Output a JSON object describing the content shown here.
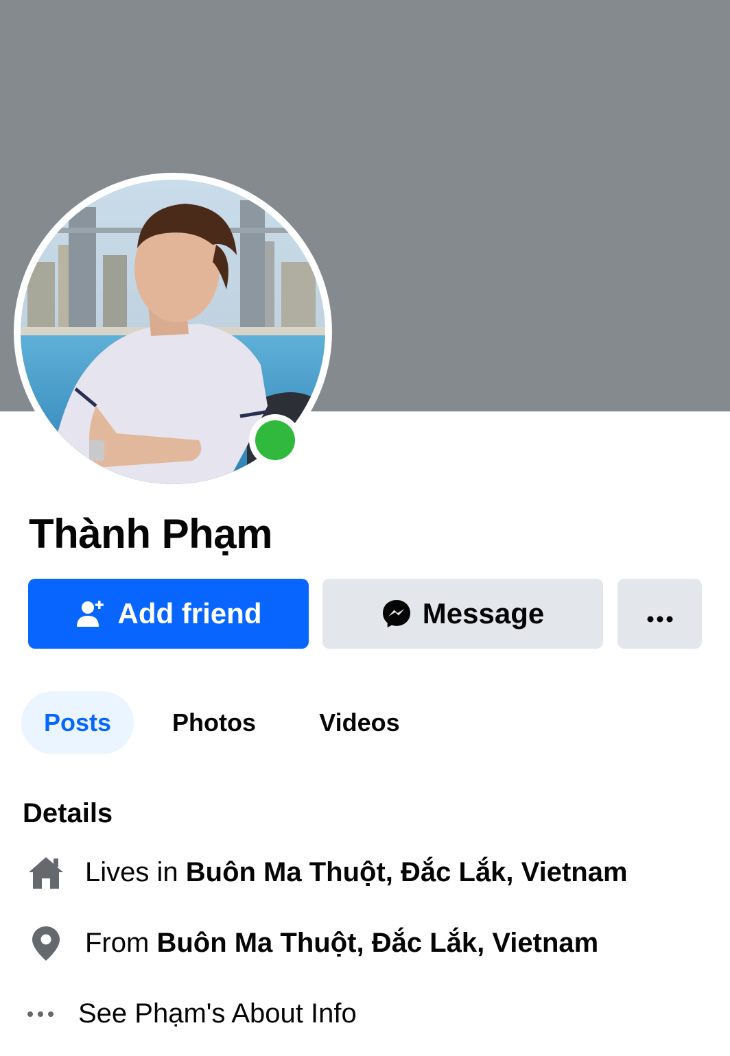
{
  "profile": {
    "name": "Thành Phạm",
    "online": true,
    "online_color": "#31b93d"
  },
  "actions": {
    "add_friend_label": "Add friend",
    "message_label": "Message",
    "more_label": "More"
  },
  "tabs": [
    {
      "label": "Posts",
      "active": true
    },
    {
      "label": "Photos",
      "active": false
    },
    {
      "label": "Videos",
      "active": false
    }
  ],
  "details": {
    "title": "Details",
    "lives_prefix": "Lives in ",
    "lives_value": "Buôn Ma Thuột, Đắc Lắk, Vietnam",
    "from_prefix": "From ",
    "from_value": "Buôn Ma Thuột, Đắc Lắk, Vietnam",
    "about_link": "See Phạm's About Info"
  },
  "colors": {
    "cover": "#858a8f",
    "primary": "#0866ff",
    "secondary_button": "#e3e6eb",
    "active_tab_bg": "#ebf5ff"
  },
  "icons": {
    "add_friend": "person-add-icon",
    "message": "messenger-icon",
    "more": "more-dots-icon",
    "lives": "home-icon",
    "from": "location-pin-icon",
    "about": "more-dots-icon"
  }
}
